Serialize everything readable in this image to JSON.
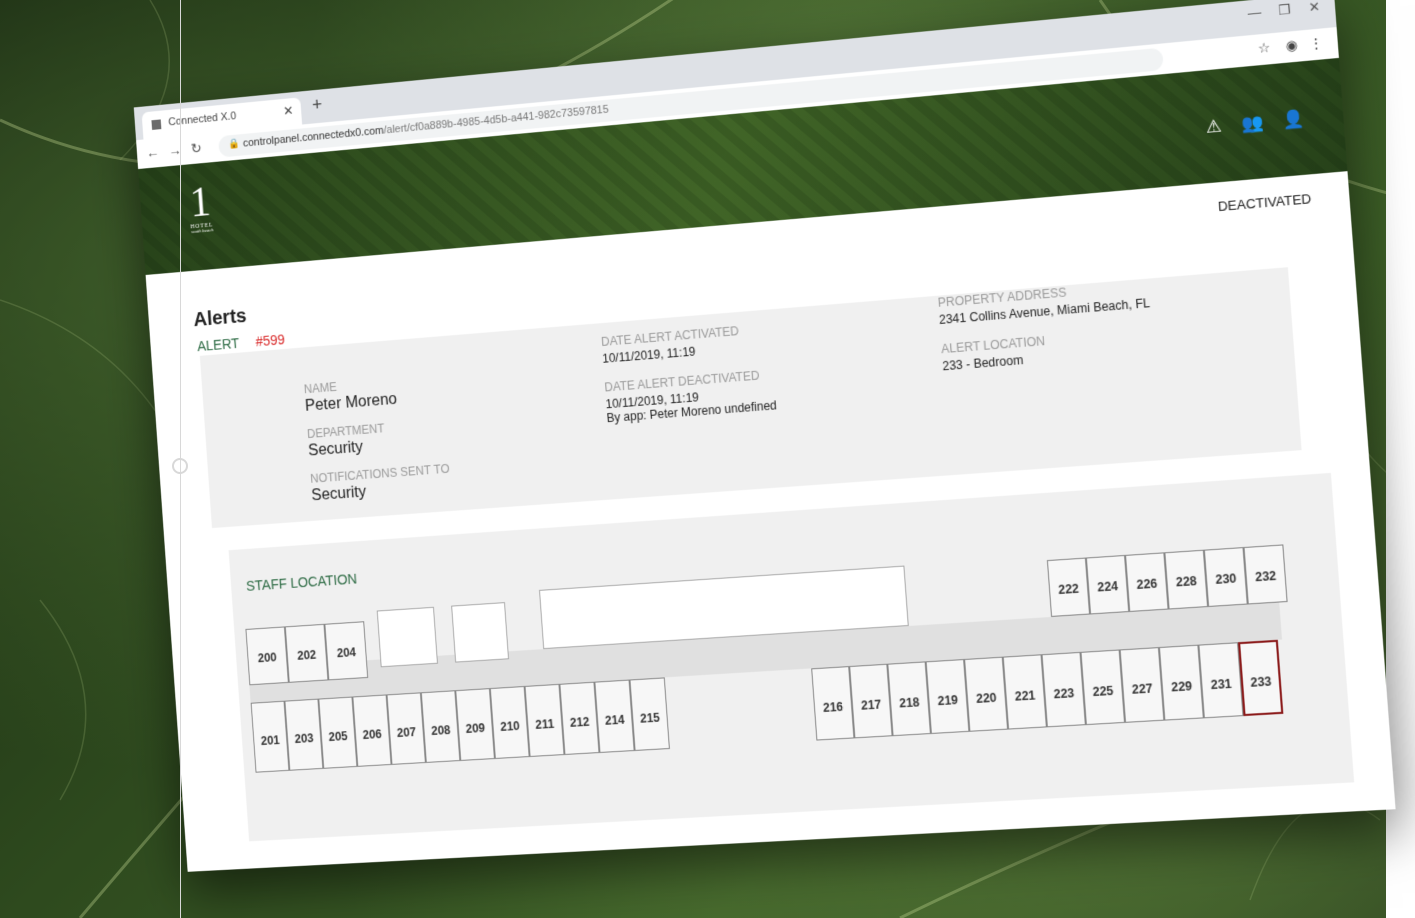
{
  "browser": {
    "tab_title": "Connected X.0",
    "url_host": "controlpanel.connectedx0.com",
    "url_path": "/alert/cf0a889b-4985-4d5b-a441-982c73597815"
  },
  "header": {
    "logo_main": "1",
    "logo_sub": "HOTEL",
    "logo_tag": "south beach"
  },
  "alert": {
    "status": "DEACTIVATED",
    "page_title": "Alerts",
    "alert_label": "ALERT",
    "alert_number": "#599"
  },
  "details": {
    "name_label": "NAME",
    "name_value": "Peter Moreno",
    "department_label": "DEPARTMENT",
    "department_value": "Security",
    "notifications_label": "NOTIFICATIONS SENT TO",
    "notifications_value": "Security",
    "activated_label": "DATE ALERT ACTIVATED",
    "activated_value": "10/11/2019, 11:19",
    "deactivated_label": "DATE ALERT DEACTIVATED",
    "deactivated_value": "10/11/2019, 11:19",
    "deactivated_by": "By app: Peter Moreno undefined",
    "address_label": "PROPERTY ADDRESS",
    "address_value": "2341 Collins Avenue, Miami Beach, FL",
    "location_label": "ALERT LOCATION",
    "location_value": "233 - Bedroom"
  },
  "map": {
    "title": "STAFF LOCATION",
    "selected_room": "233",
    "rows": {
      "top_left": [
        "200",
        "202",
        "204"
      ],
      "bottom_left": [
        "201",
        "203",
        "205",
        "206",
        "207",
        "208",
        "209",
        "210",
        "211",
        "212",
        "214",
        "215"
      ],
      "top_right": [
        "222",
        "224",
        "226",
        "228",
        "230",
        "232"
      ],
      "bottom_right": [
        "216",
        "217",
        "218",
        "219",
        "220",
        "221",
        "223",
        "225",
        "227",
        "229",
        "231",
        "233"
      ]
    }
  },
  "colors": {
    "accent_green": "#2d6b44",
    "alert_red": "#d92a2a",
    "selected_room_border": "#8b1a1a"
  }
}
